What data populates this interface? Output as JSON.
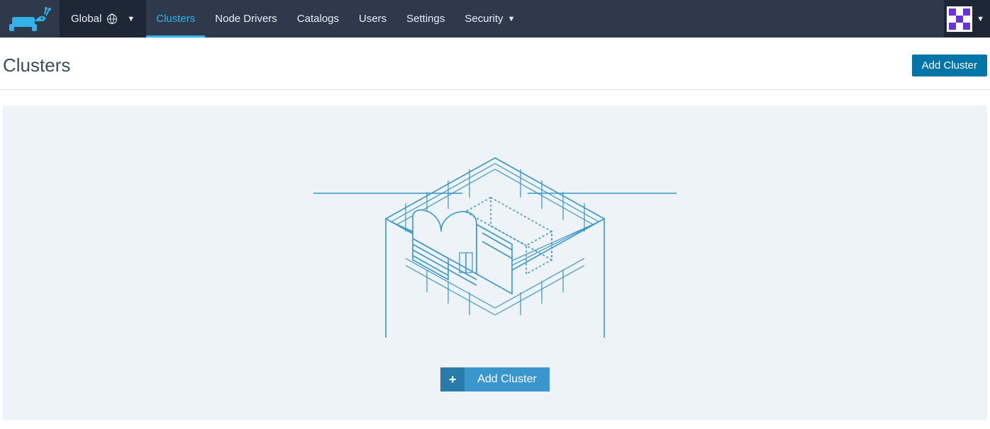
{
  "scope": {
    "label": "Global"
  },
  "nav": {
    "clusters": "Clusters",
    "node_drivers": "Node Drivers",
    "catalogs": "Catalogs",
    "users": "Users",
    "settings": "Settings",
    "security": "Security"
  },
  "page": {
    "title": "Clusters",
    "add_button": "Add Cluster"
  },
  "empty": {
    "add_label": "Add Cluster"
  }
}
